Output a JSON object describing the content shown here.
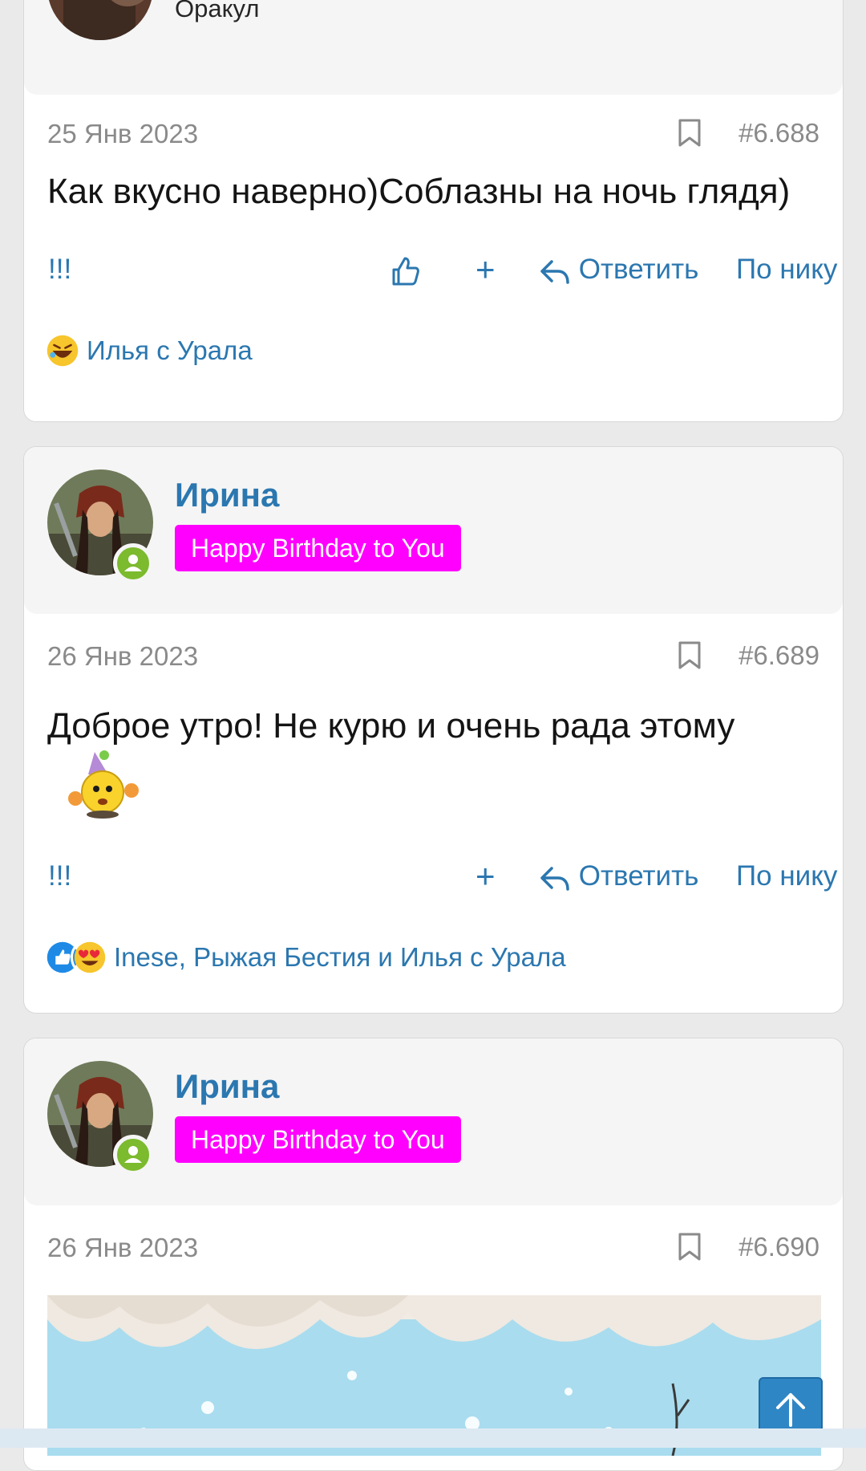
{
  "posts": [
    {
      "user_title": "Оракул",
      "date": "25 Янв 2023",
      "number": "#6.688",
      "message": "Как вкусно наверно)Соблазны на ночь глядя)",
      "actions": {
        "report": "!!!",
        "plus": "+",
        "reply": "Ответить",
        "by_nick": "По нику"
      },
      "reactions_text": "Илья с Урала"
    },
    {
      "username": "Ирина",
      "badge": "Happy Birthday to You",
      "date": "26 Янв 2023",
      "number": "#6.689",
      "message": "Доброе утро! Не курю и очень рада этому",
      "actions": {
        "report": "!!!",
        "plus": "+",
        "reply": "Ответить",
        "by_nick": "По нику"
      },
      "reactions_text": "Inese, Рыжая Бестия и Илья с Урала"
    },
    {
      "username": "Ирина",
      "badge": "Happy Birthday to You",
      "date": "26 Янв 2023",
      "number": "#6.690"
    }
  ],
  "colors": {
    "accent": "#2b77b0",
    "badge": "#ff00ff",
    "online": "#7cba2e",
    "meta": "#8a8a8a"
  },
  "icons": [
    "bookmark-icon",
    "thumbs-up-icon",
    "plus-icon",
    "reply-icon",
    "online-user-icon",
    "arrow-up-icon"
  ]
}
